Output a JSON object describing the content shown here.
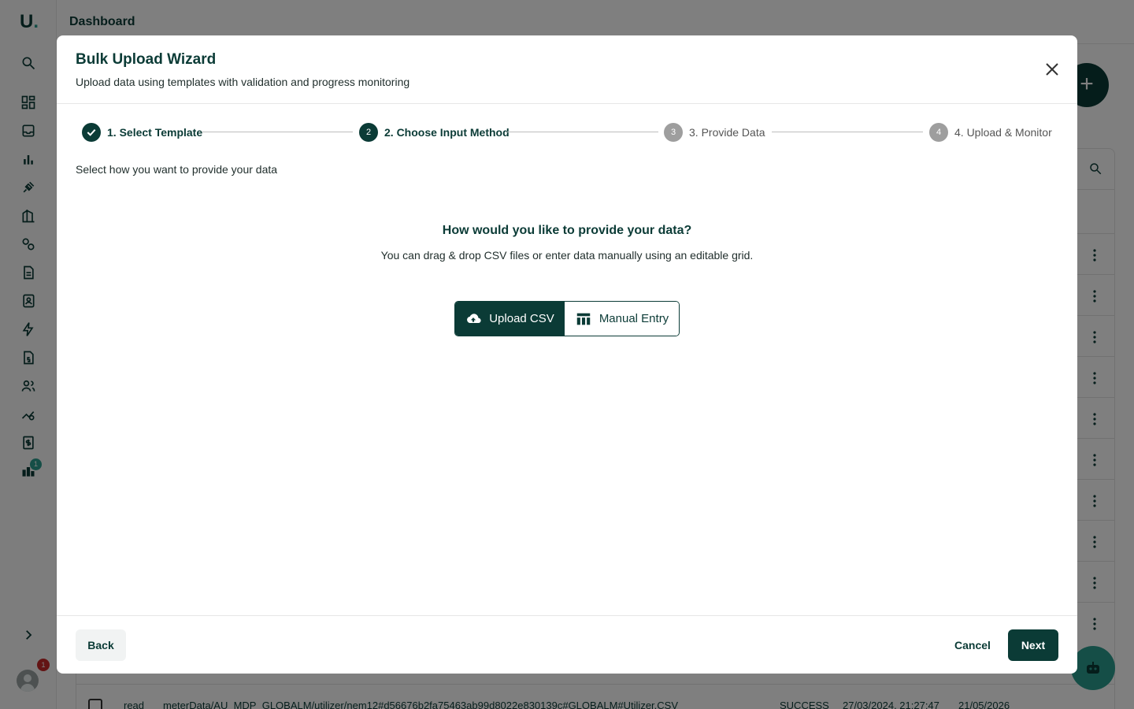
{
  "app": {
    "logo_text": "U",
    "logo_dot": ".",
    "page_title": "Dashboard",
    "sidebar_badge": "1",
    "avatar_badge": "1",
    "background_row": {
      "col1": "read",
      "col2": "meterData/AU_MDP_GLOBALM/utilizer/nem12#d56676b2fa75463ab99d8022e830139c#GLOBALM#Utilizer.CSV",
      "col3": "SUCCESS",
      "col4": "27/03/2024, 21:27:47",
      "col5": "21/05/2026"
    }
  },
  "modal": {
    "title": "Bulk Upload Wizard",
    "subtitle": "Upload data using templates with validation and progress monitoring",
    "instruction": "Select how you want to provide your data",
    "steps": [
      {
        "number": "1",
        "label": "1. Select Template",
        "state": "done"
      },
      {
        "number": "2",
        "label": "2. Choose Input Method",
        "state": "active"
      },
      {
        "number": "3",
        "label": "3. Provide Data",
        "state": "pending"
      },
      {
        "number": "4",
        "label": "4. Upload & Monitor",
        "state": "pending"
      }
    ],
    "question": "How would you like to provide your data?",
    "question_hint": "You can drag & drop CSV files or enter data manually using an editable grid.",
    "options": {
      "upload_label": "Upload CSV",
      "manual_label": "Manual Entry",
      "selected": "Upload CSV"
    },
    "footer": {
      "back_label": "Back",
      "cancel_label": "Cancel",
      "next_label": "Next"
    }
  },
  "colors": {
    "primary": "#0b3b36",
    "accent": "#2a9d8f",
    "pending_step": "#9e9e9e",
    "alert": "#c62828"
  }
}
